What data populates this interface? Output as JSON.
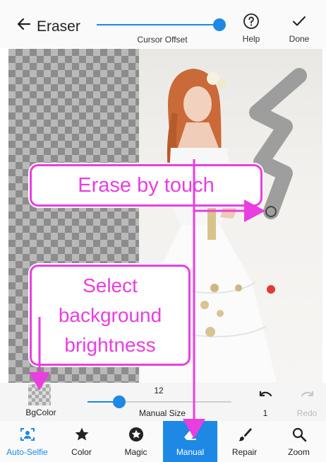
{
  "header": {
    "title": "Eraser",
    "slider_label": "Cursor Offset",
    "help_label": "Help",
    "done_label": "Done"
  },
  "callouts": {
    "erase": "Erase by touch",
    "background_lines": [
      "Select",
      "background",
      "brightness"
    ]
  },
  "controls": {
    "bgcolor_label": "BgColor",
    "size_value": "12",
    "size_label": "Manual Size",
    "undo_count": "1",
    "redo_label": "Redo"
  },
  "nav": {
    "items": [
      {
        "label": "Auto-Selfie",
        "icon": "face-scan-icon"
      },
      {
        "label": "Color",
        "icon": "star-icon"
      },
      {
        "label": "Magic",
        "icon": "magic-star-icon"
      },
      {
        "label": "Manual",
        "icon": "eraser-icon"
      },
      {
        "label": "Repair",
        "icon": "brush-icon"
      },
      {
        "label": "Zoom",
        "icon": "zoom-icon"
      }
    ],
    "active": "Manual"
  },
  "colors": {
    "accent": "#1e88e5",
    "callout": "#e93ee0",
    "erase_cursor": "#e53935"
  }
}
